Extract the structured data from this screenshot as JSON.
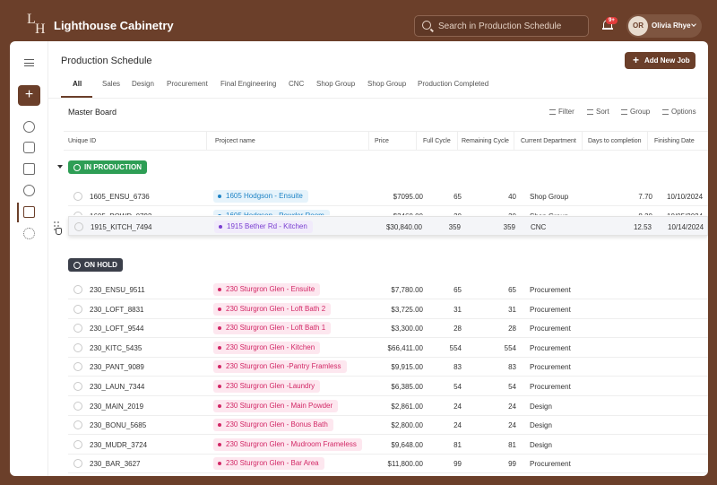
{
  "app": {
    "logo_letters": [
      "L",
      "H"
    ],
    "brand": "Lighthouse Cabinetry",
    "search_placeholder": "Search in Production Schedule",
    "notification_badge": "9+",
    "user_initials": "OR",
    "user_name": "Olivia Rhye"
  },
  "page": {
    "title": "Production Schedule",
    "add_button": "Add New Job",
    "board_title": "Master Board"
  },
  "tabs": [
    "All",
    "Sales",
    "Design",
    "Procurement",
    "Final Engineering",
    "CNC",
    "Shop Group",
    "Shop Group",
    "Production Completed"
  ],
  "active_tab": "All",
  "toolbar": {
    "filter": "Filter",
    "sort": "Sort",
    "group": "Group",
    "options": "Options"
  },
  "columns": [
    "Unique ID",
    "Projcect name",
    "Price",
    "Full Cycle",
    "Remaining Cycle",
    "Current Department",
    "Days to completion",
    "Finishing Date"
  ],
  "groups": [
    {
      "label": "IN PRODUCTION",
      "color": "#2e9e55",
      "rows": [
        {
          "uid": "1605_ENSU_6736",
          "project": "1605 Hodgson - Ensuite",
          "tag": "blue",
          "price": "$7095.00",
          "full": "65",
          "remaining": "40",
          "dept": "Shop Group",
          "days": "7.70",
          "finish": "10/10/2024"
        },
        {
          "uid": "1605_POWD_0792",
          "project": "1605 Hodgson - Powder Room",
          "tag": "blue",
          "price": "$3460.00",
          "full": "30",
          "remaining": "30",
          "dept": "Shop Group",
          "days": "8.30",
          "finish": "10/05/2024"
        },
        {
          "uid": "1915_KITCH_7494",
          "project": "1915 Bether Rd - Kitchen",
          "tag": "purple",
          "price": "$30,840.00",
          "full": "359",
          "remaining": "359",
          "dept": "CNC",
          "days": "12.53",
          "finish": "10/14/2024"
        }
      ]
    },
    {
      "label": "ON HOLD",
      "color": "#3b3f4a",
      "rows": [
        {
          "uid": "230_ENSU_9511",
          "project": "230 Sturgron Glen - Ensuite",
          "tag": "pink",
          "price": "$7,780.00",
          "full": "65",
          "remaining": "65",
          "dept": "Procurement",
          "days": "",
          "finish": ""
        },
        {
          "uid": "230_LOFT_8831",
          "project": "230 Sturgron Glen - Loft Bath 2",
          "tag": "pink",
          "price": "$3,725.00",
          "full": "31",
          "remaining": "31",
          "dept": "Procurement",
          "days": "",
          "finish": ""
        },
        {
          "uid": "230_LOFT_9544",
          "project": "230 Sturgron Glen - Loft Bath 1",
          "tag": "pink",
          "price": "$3,300.00",
          "full": "28",
          "remaining": "28",
          "dept": "Procurement",
          "days": "",
          "finish": ""
        },
        {
          "uid": "230_KITC_5435",
          "project": "230 Sturgron Glen - Kitchen",
          "tag": "pink",
          "price": "$66,411.00",
          "full": "554",
          "remaining": "554",
          "dept": "Procurement",
          "days": "",
          "finish": ""
        },
        {
          "uid": "230_PANT_9089",
          "project": "230 Sturgron Glen -Pantry Framless",
          "tag": "pink",
          "price": "$9,915.00",
          "full": "83",
          "remaining": "83",
          "dept": "Procurement",
          "days": "",
          "finish": ""
        },
        {
          "uid": "230_LAUN_7344",
          "project": "230 Sturgron Glen -Laundry",
          "tag": "pink",
          "price": "$6,385.00",
          "full": "54",
          "remaining": "54",
          "dept": "Procurement",
          "days": "",
          "finish": ""
        },
        {
          "uid": "230_MAIN_2019",
          "project": "230 Sturgron Glen - Main Powder",
          "tag": "pink",
          "price": "$2,861.00",
          "full": "24",
          "remaining": "24",
          "dept": "Design",
          "days": "",
          "finish": ""
        },
        {
          "uid": "230_BONU_5685",
          "project": "230 Sturgron Glen - Bonus Bath",
          "tag": "pink",
          "price": "$2,800.00",
          "full": "24",
          "remaining": "24",
          "dept": "Design",
          "days": "",
          "finish": ""
        },
        {
          "uid": "230_MUDR_3724",
          "project": "230 Sturgron Glen - Mudroom Frameless",
          "tag": "pink",
          "price": "$9,648.00",
          "full": "81",
          "remaining": "81",
          "dept": "Design",
          "days": "",
          "finish": ""
        },
        {
          "uid": "230_BAR_3627",
          "project": "230 Sturgron Glen - Bar Area",
          "tag": "pink",
          "price": "$11,800.00",
          "full": "99",
          "remaining": "99",
          "dept": "Procurement",
          "days": "",
          "finish": ""
        }
      ]
    }
  ]
}
